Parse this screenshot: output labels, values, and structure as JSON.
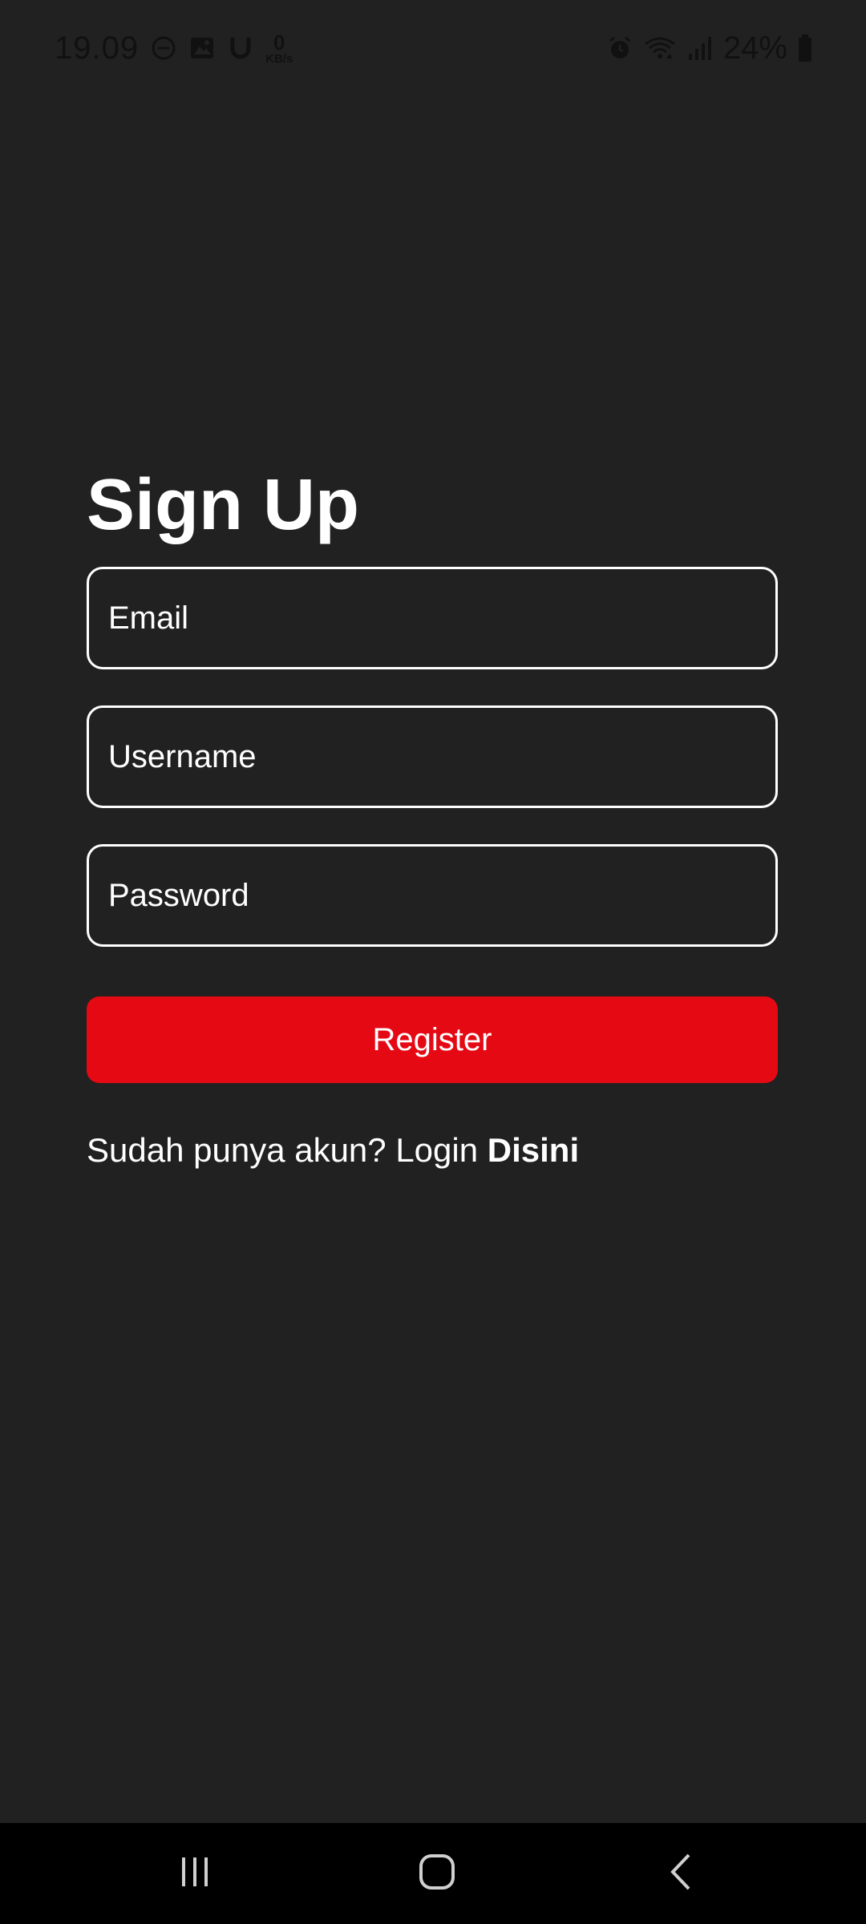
{
  "status_bar": {
    "time": "19.09",
    "network_speed_value": "0",
    "network_speed_unit": "KB/s",
    "battery": "24%",
    "icons": [
      "dnd-icon",
      "gallery-icon",
      "u-icon",
      "alarm-icon",
      "wifi-icon",
      "signal-icon",
      "battery-icon"
    ]
  },
  "signup": {
    "title": "Sign Up",
    "email_placeholder": "Email",
    "username_placeholder": "Username",
    "password_placeholder": "Password",
    "register_label": "Register",
    "login_prompt": "Sudah punya akun? Login",
    "login_link": "Disini"
  },
  "nav_bar": {
    "icons": [
      "recent-apps-icon",
      "home-icon",
      "back-icon"
    ]
  },
  "colors": {
    "background": "#212121",
    "accent": "#e50914",
    "text": "#ffffff"
  }
}
